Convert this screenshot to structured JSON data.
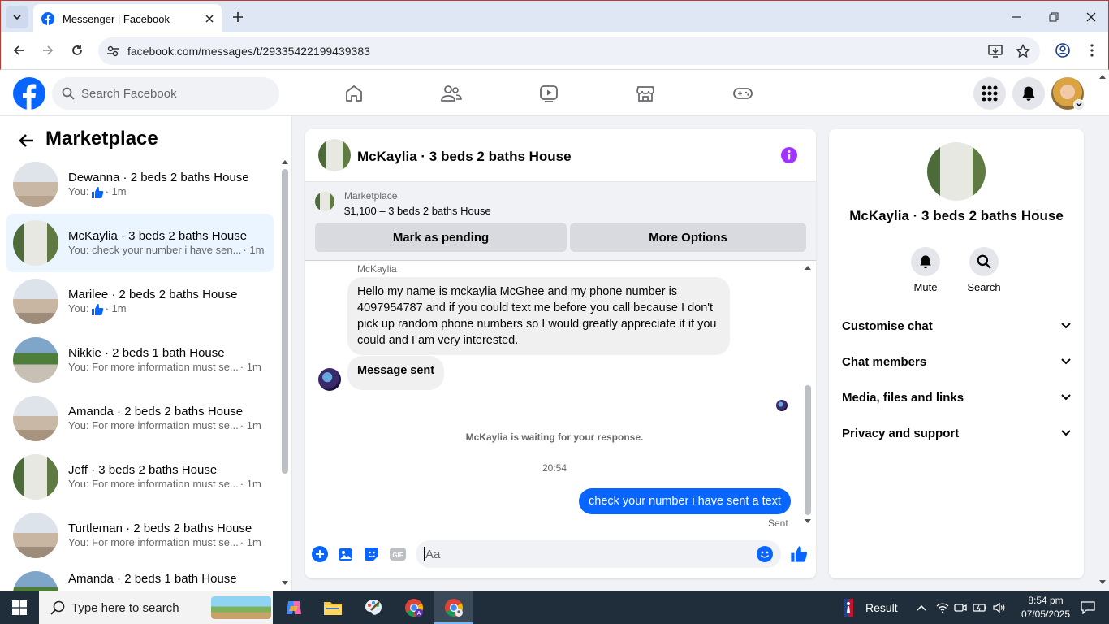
{
  "browser": {
    "tab_title": "Messenger | Facebook",
    "url": "facebook.com/messages/t/29335422199439383"
  },
  "header": {
    "search_placeholder": "Search Facebook"
  },
  "sidebar": {
    "title": "Marketplace",
    "conversations": [
      {
        "name": "Dewanna · 2 beds 2 baths House",
        "preview": "You:",
        "time": "· 1m",
        "like": true
      },
      {
        "name": "McKaylia · 3 beds 2 baths House",
        "preview": "You: check your number i have sen...",
        "time": "· 1m",
        "active": true
      },
      {
        "name": "Marilee · 2 beds 2 baths House",
        "preview": "You:",
        "time": "· 1m",
        "like": true
      },
      {
        "name": "Nikkie · 2 beds 1 bath House",
        "preview": "You: For more information must se...",
        "time": "· 1m"
      },
      {
        "name": "Amanda · 2 beds 2 baths House",
        "preview": "You: For more information must se...",
        "time": "· 1m"
      },
      {
        "name": "Jeff · 3 beds 2 baths House",
        "preview": "You: For more information must se...",
        "time": "· 1m"
      },
      {
        "name": "Turtleman · 2 beds 2 baths House",
        "preview": "You: For more information must se...",
        "time": "· 1m"
      },
      {
        "name": "Amanda · 2 beds 1 bath House",
        "preview": "",
        "time": ""
      }
    ]
  },
  "chat": {
    "title": "McKaylia · 3 beds 2 baths House",
    "marketplace_label": "Marketplace",
    "listing": "$1,100 – 3 beds 2 baths House",
    "btn_pending": "Mark as pending",
    "btn_options": "More Options",
    "sender_name": "McKaylia",
    "incoming_message": "Hello my name is mckaylia McGhee and my phone number is 4097954787 and if you could text me before you call because I don't pick up random phone numbers so I would greatly appreciate it if you could and I am very interested.",
    "system_message": "Message sent",
    "waiting_notice": "McKaylia is waiting for your response.",
    "timestamp": "20:54",
    "outgoing_message": "check your number i have sent a text",
    "sent_status": "Sent",
    "composer_placeholder": "Aa"
  },
  "info_panel": {
    "title": "McKaylia · 3 beds 2 baths House",
    "mute": "Mute",
    "search": "Search",
    "sections": [
      "Customise chat",
      "Chat members",
      "Media, files and links",
      "Privacy and support"
    ]
  },
  "taskbar": {
    "search_placeholder": "Type here to search",
    "widget_label": "Result",
    "time": "8:54 pm",
    "date": "07/05/2025"
  },
  "colors": {
    "fb_blue": "#0866ff",
    "active_row": "#ebf5ff",
    "info_purple": "#a033ff"
  }
}
